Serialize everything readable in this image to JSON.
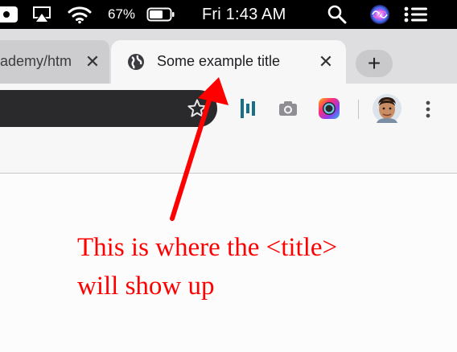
{
  "menubar": {
    "battery_percent": "67%",
    "clock": "Fri 1:43 AM",
    "icons": [
      "record-icon",
      "airplay-icon",
      "wifi-icon",
      "battery-icon",
      "spotlight-icon",
      "siri-icon",
      "control-center-icon"
    ]
  },
  "tabs": [
    {
      "title": "ademy/htm",
      "active": false,
      "favicon": "none"
    },
    {
      "title": "Some example title",
      "active": true,
      "favicon": "globe-icon"
    }
  ],
  "toolbar": {
    "icons": [
      "bookmark-star-icon",
      "extension-bars-icon",
      "camera-icon",
      "color-circle-icon",
      "profile-avatar",
      "menu-dots-icon"
    ]
  },
  "annotation": {
    "line1": "This is where the <title>",
    "line2": "will show up",
    "color": "#ff0000"
  },
  "colors": {
    "tabstrip": "#dedee1",
    "active_tab": "#f7f7f8",
    "inactive_tab": "#cdcdd0",
    "omnibox": "#2a2a2d"
  }
}
